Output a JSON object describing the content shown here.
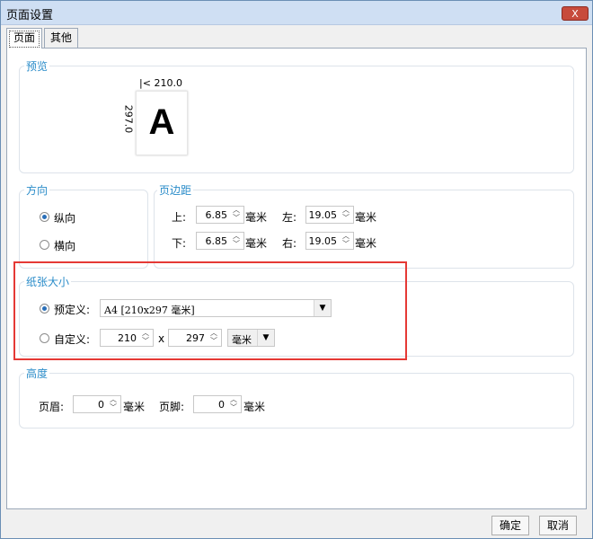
{
  "window": {
    "title": "页面设置",
    "close_label": "X"
  },
  "tabs": [
    {
      "label": "页面"
    },
    {
      "label": "其他"
    }
  ],
  "preview": {
    "label": "预览",
    "width": "|< 210.0 >|",
    "height": "297.0",
    "letter": "A"
  },
  "orientation": {
    "label": "方向",
    "portrait": "纵向",
    "landscape": "横向",
    "selected": "portrait"
  },
  "margins": {
    "label": "页边距",
    "top": {
      "label": "上:",
      "value": "6.85",
      "unit": "毫米"
    },
    "bottom": {
      "label": "下:",
      "value": "6.85",
      "unit": "毫米"
    },
    "left": {
      "label": "左:",
      "value": "19.05",
      "unit": "毫米"
    },
    "right": {
      "label": "右:",
      "value": "19.05",
      "unit": "毫米"
    }
  },
  "paper": {
    "label": "纸张大小",
    "predefined_label": "预定义:",
    "predefined_value": "A4 [210x297 毫米]",
    "custom_label": "自定义:",
    "custom_width": "210",
    "x_sep": "x",
    "custom_height": "297",
    "unit": "毫米"
  },
  "height": {
    "label": "高度",
    "header_label": "页眉:",
    "header_value": "0",
    "footer_label": "页脚:",
    "footer_value": "0",
    "unit": "毫米"
  },
  "buttons": {
    "ok": "确定",
    "cancel": "取消"
  },
  "colors": {
    "accent": "#2a8cc9",
    "highlight": "#e53935"
  }
}
